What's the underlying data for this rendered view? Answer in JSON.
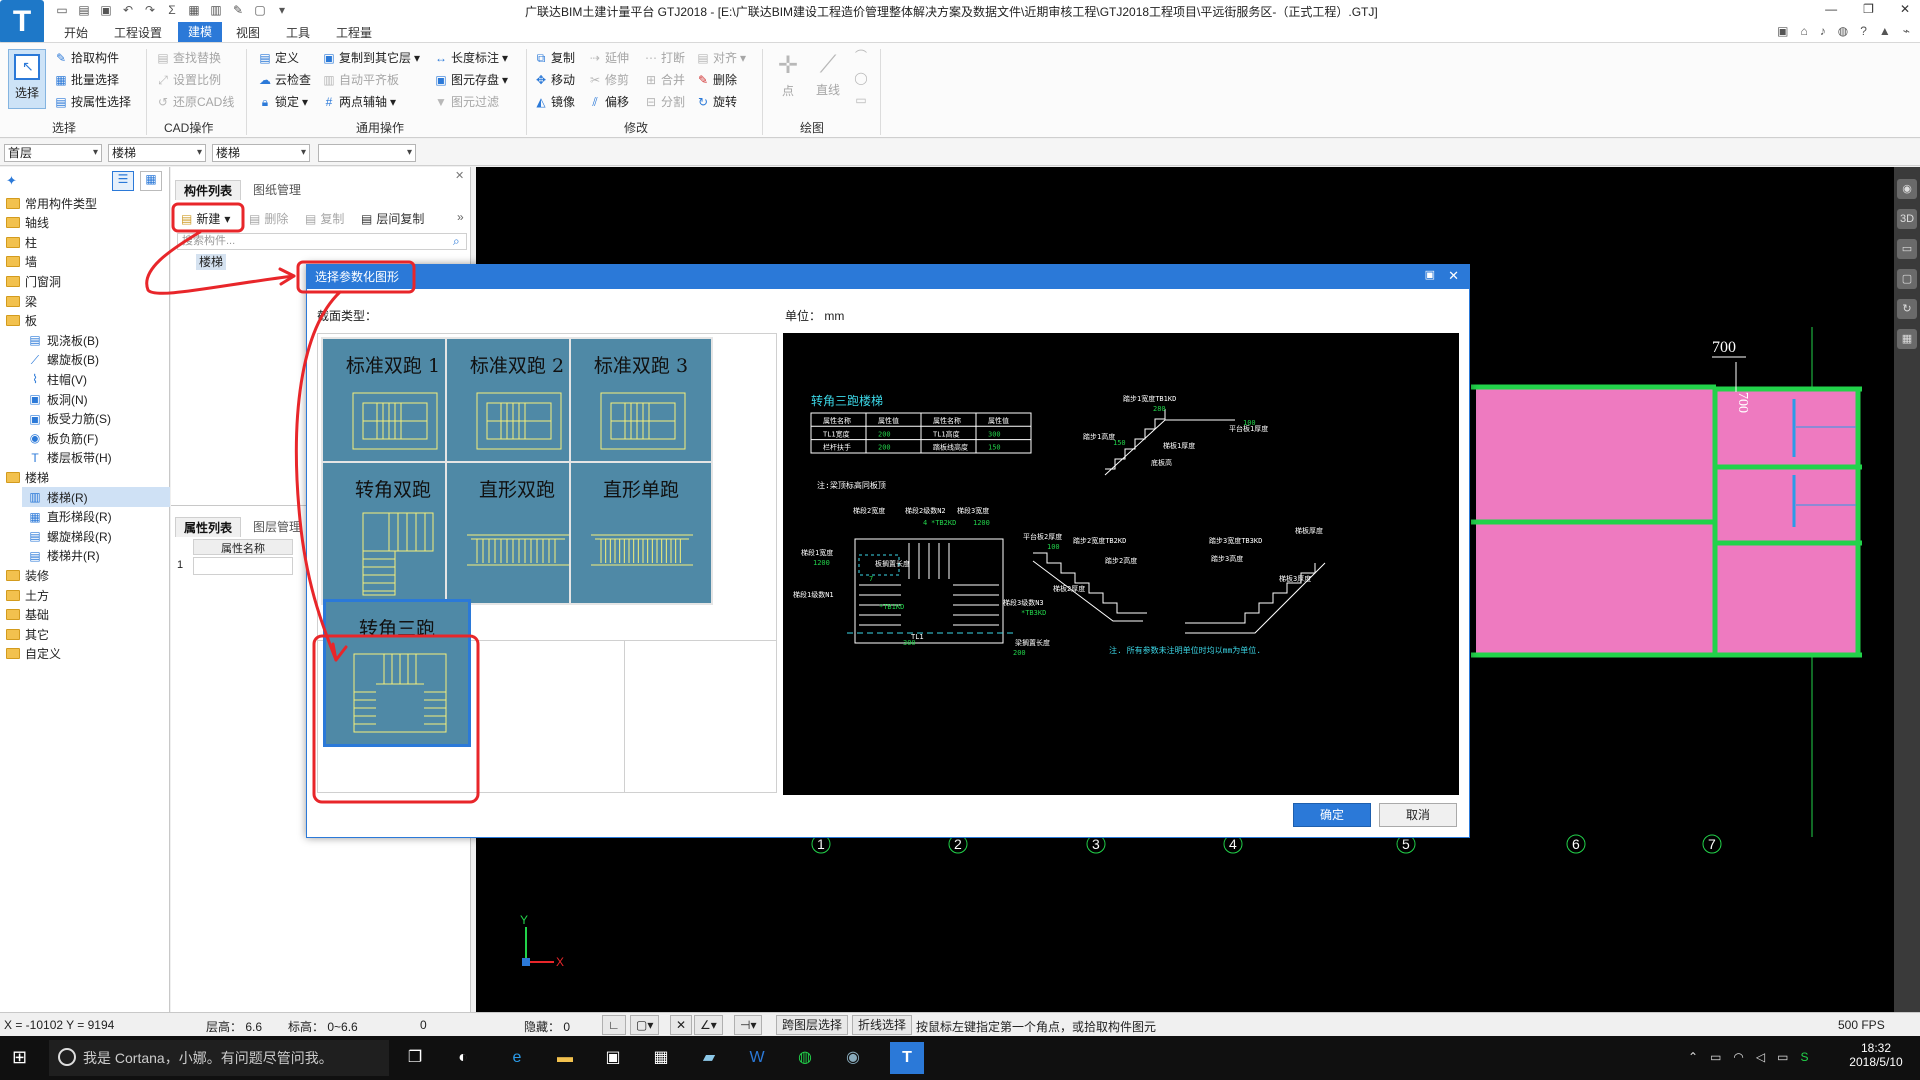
{
  "titlebar": {
    "title": "广联达BIM土建计量平台 GTJ2018 - [E:\\广联达BIM建设工程造价管理整体解决方案及数据文件\\近期审核工程\\GTJ2018工程项目\\平远街服务区-（正式工程）.GTJ]"
  },
  "menu": {
    "items": [
      "开始",
      "工程设置",
      "建模",
      "视图",
      "工具",
      "工程量"
    ],
    "active_index": 2
  },
  "ribbon": {
    "select_group": {
      "big_button": "选择",
      "items": [
        "拾取构件",
        "批量选择",
        "按属性选择"
      ],
      "label": "选择"
    },
    "cad_group": {
      "items": [
        "查找替换",
        "设置比例",
        "还原CAD线"
      ],
      "label": "CAD操作"
    },
    "common_group": {
      "items": [
        "定义",
        "云检查",
        "锁定",
        "复制到其它层",
        "自动平齐板",
        "两点辅轴",
        "长度标注",
        "图元存盘",
        "图元过滤"
      ],
      "label": "通用操作"
    },
    "modify_group": {
      "items": [
        "复制",
        "移动",
        "镜像",
        "延伸",
        "修剪",
        "偏移",
        "打断",
        "合并",
        "分割",
        "对齐",
        "删除",
        "旋转"
      ],
      "label": "修改"
    },
    "draw_group": {
      "items": [
        "点",
        "直线"
      ],
      "label": "绘图"
    }
  },
  "floorbar": {
    "floor": "首层",
    "category": "楼梯",
    "type": "楼梯",
    "extra": ""
  },
  "leftnav": {
    "items": [
      {
        "label": "常用构件类型",
        "level": 0
      },
      {
        "label": "轴线",
        "level": 0
      },
      {
        "label": "柱",
        "level": 0
      },
      {
        "label": "墙",
        "level": 0
      },
      {
        "label": "门窗洞",
        "level": 0
      },
      {
        "label": "梁",
        "level": 0
      },
      {
        "label": "板",
        "level": 0
      },
      {
        "label": "现浇板(B)",
        "level": 1
      },
      {
        "label": "螺旋板(B)",
        "level": 1
      },
      {
        "label": "柱帽(V)",
        "level": 1
      },
      {
        "label": "板洞(N)",
        "level": 1
      },
      {
        "label": "板受力筋(S)",
        "level": 1
      },
      {
        "label": "板负筋(F)",
        "level": 1
      },
      {
        "label": "楼层板带(H)",
        "level": 1
      },
      {
        "label": "楼梯",
        "level": 0
      },
      {
        "label": "楼梯(R)",
        "level": 1,
        "selected": true
      },
      {
        "label": "直形梯段(R)",
        "level": 1
      },
      {
        "label": "螺旋梯段(R)",
        "level": 1
      },
      {
        "label": "楼梯井(R)",
        "level": 1
      },
      {
        "label": "装修",
        "level": 0
      },
      {
        "label": "土方",
        "level": 0
      },
      {
        "label": "基础",
        "level": 0
      },
      {
        "label": "其它",
        "level": 0
      },
      {
        "label": "自定义",
        "level": 0
      }
    ]
  },
  "complist": {
    "tabs": [
      "构件列表",
      "图纸管理"
    ],
    "tools": {
      "new": "新建",
      "delete": "删除",
      "copy": "复制",
      "floor_copy": "层间复制"
    },
    "search_placeholder": "搜索构件...",
    "tree_item": "楼梯",
    "prop_tabs": [
      "属性列表",
      "图层管理"
    ],
    "prop_header": "属性名称",
    "prop_row_num": "1"
  },
  "dialog": {
    "title": "选择参数化图形",
    "section_label": "截面类型：",
    "unit_label": "单位：  mm",
    "tiles": [
      "标准双跑 1",
      "标准双跑 2",
      "标准双跑 3",
      "转角双跑",
      "直形双跑",
      "直形单跑",
      "转角三跑"
    ],
    "ok": "确定",
    "cancel": "取消"
  },
  "preview": {
    "title": "转角三跑楼梯",
    "table": [
      [
        "属性名称",
        "属性值",
        "属性名称",
        "属性值"
      ],
      [
        "TL1宽度",
        "200",
        "TL1高度",
        "300"
      ],
      [
        "栏杆扶手",
        "200",
        "踏板线高度",
        "150"
      ]
    ],
    "note1": "注:梁顶标高同板顶",
    "note2": "注. 所有参数未注明单位时均以mm为单位.",
    "labels": [
      "踏步1宽度TB1KD",
      "踏步1高度",
      "梯板1厚度",
      "底板高",
      "平台板1厚度",
      "梯段1宽度",
      "梯段2级数N2",
      "梯段3宽度",
      "梯段2宽度",
      "梯段1级数N1",
      "梯段3级数N3",
      "平台板2厚度",
      "踏步2宽度TB2KD",
      "踏步2高度",
      "梯板2厚度",
      "踏步3宽度TB3KD",
      "踏步3高度",
      "梯板3厚度",
      "梯板厚度",
      "板搁置长度",
      "梁搁置长度",
      "TL1"
    ],
    "values": [
      "280",
      "150",
      "100",
      "1200",
      "4",
      "*TB2KD",
      "1200",
      "7",
      "*TB1KD",
      "*TB3KD",
      "100",
      "200",
      "300"
    ]
  },
  "canvas": {
    "dim_top": "700",
    "dim_right": "700",
    "axes": [
      "1",
      "2",
      "3",
      "4",
      "5",
      "6",
      "7"
    ],
    "axis_x": "X",
    "axis_y": "Y"
  },
  "status": {
    "coords": "X = -10102 Y = 9194",
    "floor_height": "层高：  6.6",
    "elevation": "标高：  0~6.6",
    "zero": "0",
    "hidden": "隐藏：  0",
    "btn_cross_layer": "跨图层选择",
    "btn_polyline": "折线选择",
    "hint": "按鼠标左键指定第一个角点，或拾取构件图元",
    "fps": "500 FPS"
  },
  "taskbar": {
    "cortana": "我是 Cortana，小娜。有问题尽管问我。",
    "time": "18:32",
    "date": "2018/5/10"
  },
  "colors": {
    "accent": "#2b79d8",
    "tile": "#4f89a6",
    "annotation": "#e8262a",
    "pink": "#ee7ac0",
    "green": "#22d24a"
  }
}
